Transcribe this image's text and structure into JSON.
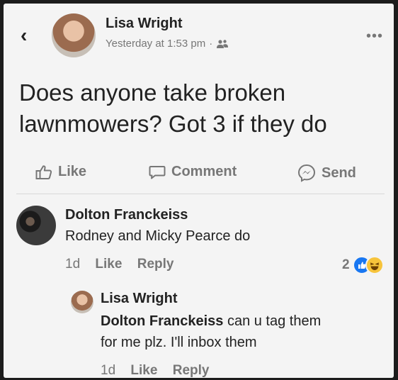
{
  "post": {
    "author": "Lisa Wright",
    "timestamp": "Yesterday at 1:53 pm",
    "separator": "·",
    "audience_icon": "friends-icon",
    "text": "Does anyone take broken lawnmowers? Got 3 if they do"
  },
  "actions": {
    "like": "Like",
    "comment": "Comment",
    "send": "Send"
  },
  "comments": [
    {
      "author": "Dolton Franckeiss",
      "text": "Rodney and Micky Pearce do",
      "time": "1d",
      "like": "Like",
      "reply": "Reply",
      "reaction_count": "2",
      "reaction_icons": [
        "like-reaction-icon",
        "haha-reaction-icon"
      ]
    },
    {
      "author": "Lisa Wright",
      "tag": "Dolton Franckeiss",
      "text_line1": "can u tag them",
      "text_line2": "for me plz. I'll inbox them",
      "time": "1d",
      "like": "Like",
      "reply": "Reply"
    }
  ],
  "colors": {
    "like_blue": "#1877f2",
    "haha_yellow": "#f7c43b",
    "secondary_text": "#777777"
  }
}
